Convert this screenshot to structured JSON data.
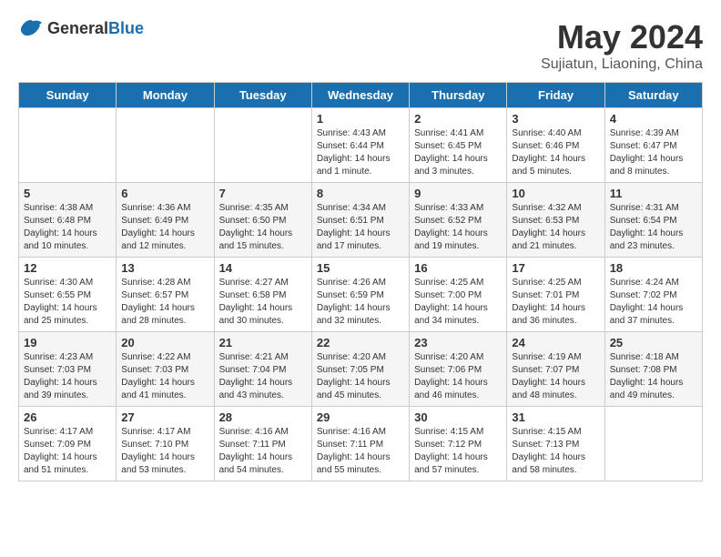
{
  "header": {
    "logo_general": "General",
    "logo_blue": "Blue",
    "month_title": "May 2024",
    "subtitle": "Sujiatun, Liaoning, China"
  },
  "days_of_week": [
    "Sunday",
    "Monday",
    "Tuesday",
    "Wednesday",
    "Thursday",
    "Friday",
    "Saturday"
  ],
  "weeks": [
    [
      {
        "day": "",
        "info": ""
      },
      {
        "day": "",
        "info": ""
      },
      {
        "day": "",
        "info": ""
      },
      {
        "day": "1",
        "info": "Sunrise: 4:43 AM\nSunset: 6:44 PM\nDaylight: 14 hours\nand 1 minute."
      },
      {
        "day": "2",
        "info": "Sunrise: 4:41 AM\nSunset: 6:45 PM\nDaylight: 14 hours\nand 3 minutes."
      },
      {
        "day": "3",
        "info": "Sunrise: 4:40 AM\nSunset: 6:46 PM\nDaylight: 14 hours\nand 5 minutes."
      },
      {
        "day": "4",
        "info": "Sunrise: 4:39 AM\nSunset: 6:47 PM\nDaylight: 14 hours\nand 8 minutes."
      }
    ],
    [
      {
        "day": "5",
        "info": "Sunrise: 4:38 AM\nSunset: 6:48 PM\nDaylight: 14 hours\nand 10 minutes."
      },
      {
        "day": "6",
        "info": "Sunrise: 4:36 AM\nSunset: 6:49 PM\nDaylight: 14 hours\nand 12 minutes."
      },
      {
        "day": "7",
        "info": "Sunrise: 4:35 AM\nSunset: 6:50 PM\nDaylight: 14 hours\nand 15 minutes."
      },
      {
        "day": "8",
        "info": "Sunrise: 4:34 AM\nSunset: 6:51 PM\nDaylight: 14 hours\nand 17 minutes."
      },
      {
        "day": "9",
        "info": "Sunrise: 4:33 AM\nSunset: 6:52 PM\nDaylight: 14 hours\nand 19 minutes."
      },
      {
        "day": "10",
        "info": "Sunrise: 4:32 AM\nSunset: 6:53 PM\nDaylight: 14 hours\nand 21 minutes."
      },
      {
        "day": "11",
        "info": "Sunrise: 4:31 AM\nSunset: 6:54 PM\nDaylight: 14 hours\nand 23 minutes."
      }
    ],
    [
      {
        "day": "12",
        "info": "Sunrise: 4:30 AM\nSunset: 6:55 PM\nDaylight: 14 hours\nand 25 minutes."
      },
      {
        "day": "13",
        "info": "Sunrise: 4:28 AM\nSunset: 6:57 PM\nDaylight: 14 hours\nand 28 minutes."
      },
      {
        "day": "14",
        "info": "Sunrise: 4:27 AM\nSunset: 6:58 PM\nDaylight: 14 hours\nand 30 minutes."
      },
      {
        "day": "15",
        "info": "Sunrise: 4:26 AM\nSunset: 6:59 PM\nDaylight: 14 hours\nand 32 minutes."
      },
      {
        "day": "16",
        "info": "Sunrise: 4:25 AM\nSunset: 7:00 PM\nDaylight: 14 hours\nand 34 minutes."
      },
      {
        "day": "17",
        "info": "Sunrise: 4:25 AM\nSunset: 7:01 PM\nDaylight: 14 hours\nand 36 minutes."
      },
      {
        "day": "18",
        "info": "Sunrise: 4:24 AM\nSunset: 7:02 PM\nDaylight: 14 hours\nand 37 minutes."
      }
    ],
    [
      {
        "day": "19",
        "info": "Sunrise: 4:23 AM\nSunset: 7:03 PM\nDaylight: 14 hours\nand 39 minutes."
      },
      {
        "day": "20",
        "info": "Sunrise: 4:22 AM\nSunset: 7:03 PM\nDaylight: 14 hours\nand 41 minutes."
      },
      {
        "day": "21",
        "info": "Sunrise: 4:21 AM\nSunset: 7:04 PM\nDaylight: 14 hours\nand 43 minutes."
      },
      {
        "day": "22",
        "info": "Sunrise: 4:20 AM\nSunset: 7:05 PM\nDaylight: 14 hours\nand 45 minutes."
      },
      {
        "day": "23",
        "info": "Sunrise: 4:20 AM\nSunset: 7:06 PM\nDaylight: 14 hours\nand 46 minutes."
      },
      {
        "day": "24",
        "info": "Sunrise: 4:19 AM\nSunset: 7:07 PM\nDaylight: 14 hours\nand 48 minutes."
      },
      {
        "day": "25",
        "info": "Sunrise: 4:18 AM\nSunset: 7:08 PM\nDaylight: 14 hours\nand 49 minutes."
      }
    ],
    [
      {
        "day": "26",
        "info": "Sunrise: 4:17 AM\nSunset: 7:09 PM\nDaylight: 14 hours\nand 51 minutes."
      },
      {
        "day": "27",
        "info": "Sunrise: 4:17 AM\nSunset: 7:10 PM\nDaylight: 14 hours\nand 53 minutes."
      },
      {
        "day": "28",
        "info": "Sunrise: 4:16 AM\nSunset: 7:11 PM\nDaylight: 14 hours\nand 54 minutes."
      },
      {
        "day": "29",
        "info": "Sunrise: 4:16 AM\nSunset: 7:11 PM\nDaylight: 14 hours\nand 55 minutes."
      },
      {
        "day": "30",
        "info": "Sunrise: 4:15 AM\nSunset: 7:12 PM\nDaylight: 14 hours\nand 57 minutes."
      },
      {
        "day": "31",
        "info": "Sunrise: 4:15 AM\nSunset: 7:13 PM\nDaylight: 14 hours\nand 58 minutes."
      },
      {
        "day": "",
        "info": ""
      }
    ]
  ]
}
